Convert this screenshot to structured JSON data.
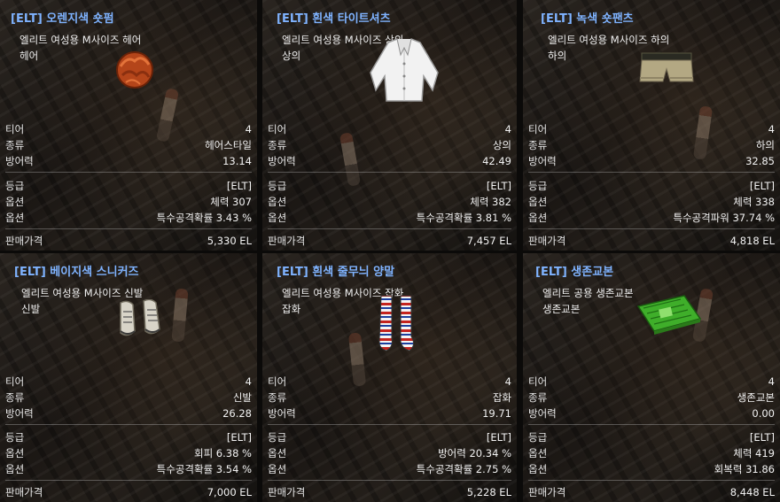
{
  "labels": {
    "tier": "티어",
    "kind": "종류",
    "defense": "방어력",
    "grade": "등급",
    "option": "옵션",
    "price": "판매가격"
  },
  "items": [
    {
      "title": "[ELT] 오렌지색 숏펌",
      "desc1": "엘리트 여성용 M사이즈 헤어",
      "desc2": "헤어",
      "icon": "hair-icon",
      "tier": "4",
      "kind": "헤어스타일",
      "defense": "13.14",
      "grade": "[ELT]",
      "option1": "체력 307",
      "option2": "특수공격확률 3.43 %",
      "price": "5,330 EL"
    },
    {
      "title": "[ELT] 흰색 타이트셔츠",
      "desc1": "엘리트 여성용 M사이즈 상의",
      "desc2": "상의",
      "icon": "shirt-icon",
      "tier": "4",
      "kind": "상의",
      "defense": "42.49",
      "grade": "[ELT]",
      "option1": "체력 382",
      "option2": "특수공격확률 3.81 %",
      "price": "7,457 EL"
    },
    {
      "title": "[ELT] 녹색 숏팬츠",
      "desc1": "엘리트 여성용 M사이즈 하의",
      "desc2": "하의",
      "icon": "shorts-icon",
      "tier": "4",
      "kind": "하의",
      "defense": "32.85",
      "grade": "[ELT]",
      "option1": "체력 338",
      "option2": "특수공격파워 37.74 %",
      "price": "4,818 EL"
    },
    {
      "title": "[ELT] 베이지색 스니커즈",
      "desc1": "엘리트 여성용 M사이즈 신발",
      "desc2": "신발",
      "icon": "sneakers-icon",
      "tier": "4",
      "kind": "신발",
      "defense": "26.28",
      "grade": "[ELT]",
      "option1": "회피 6.38 %",
      "option2": "특수공격확률 3.54 %",
      "price": "7,000 EL"
    },
    {
      "title": "[ELT] 흰색 줄무늬 양말",
      "desc1": "엘리트 여성용 M사이즈 잡화",
      "desc2": "잡화",
      "icon": "socks-icon",
      "tier": "4",
      "kind": "잡화",
      "defense": "19.71",
      "grade": "[ELT]",
      "option1": "방어력 20.34 %",
      "option2": "특수공격확률 2.75 %",
      "price": "5,228 EL"
    },
    {
      "title": "[ELT] 생존교본",
      "desc1": "엘리트 공용 생존교본",
      "desc2": "생존교본",
      "icon": "book-icon",
      "tier": "4",
      "kind": "생존교본",
      "defense": "0.00",
      "grade": "[ELT]",
      "option1": "체력 419",
      "option2": "회복력 31.86",
      "price": "8,448 EL"
    }
  ]
}
